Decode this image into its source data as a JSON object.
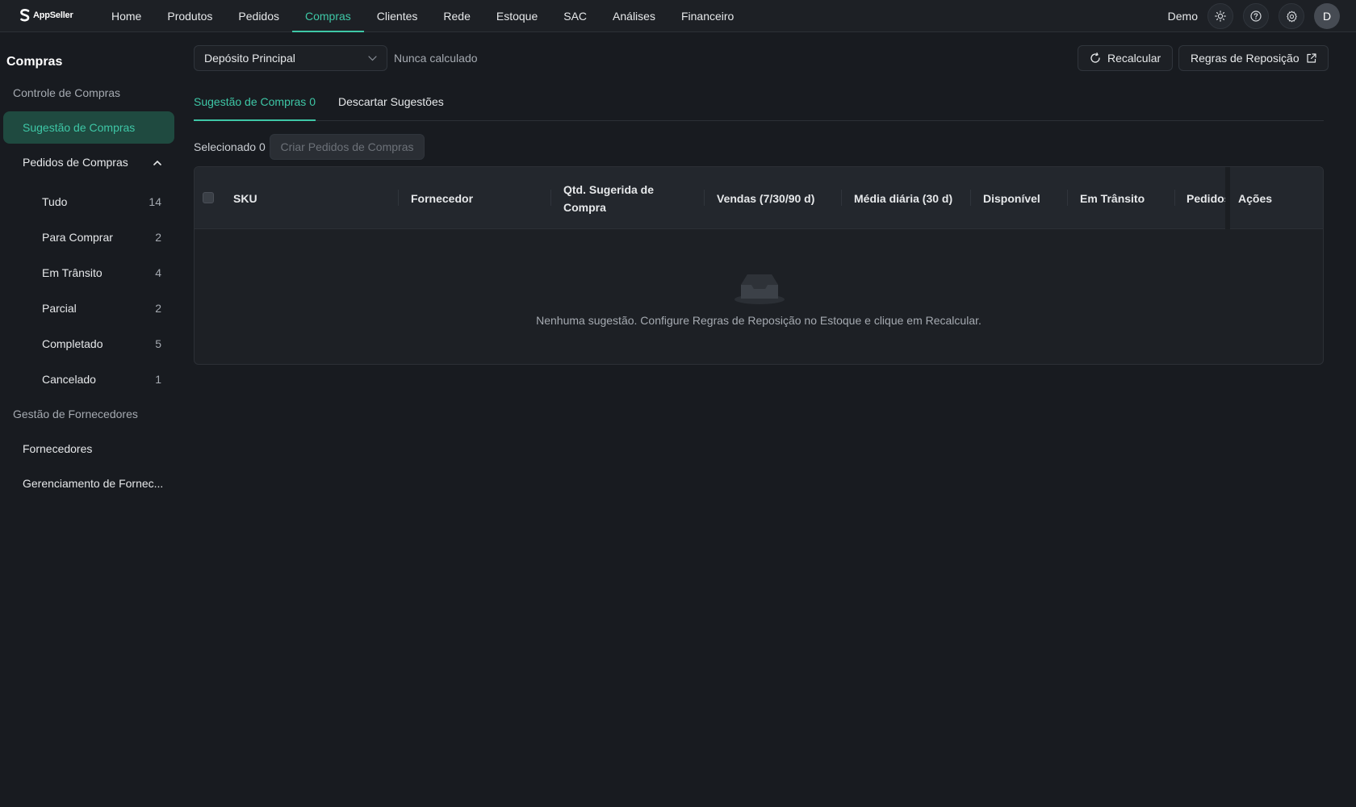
{
  "app": {
    "logo_text": "AppSeller"
  },
  "nav": {
    "items": [
      {
        "label": "Home"
      },
      {
        "label": "Produtos"
      },
      {
        "label": "Pedidos"
      },
      {
        "label": "Compras"
      },
      {
        "label": "Clientes"
      },
      {
        "label": "Rede"
      },
      {
        "label": "Estoque"
      },
      {
        "label": "SAC"
      },
      {
        "label": "Análises"
      },
      {
        "label": "Financeiro"
      }
    ],
    "active": "Compras"
  },
  "header_right": {
    "user_name": "Demo",
    "avatar_initial": "D"
  },
  "sidebar": {
    "title": "Compras",
    "group_control": "Controle de Compras",
    "suggestion": "Sugestão de Compras",
    "orders": "Pedidos de Compras",
    "sub": [
      {
        "label": "Tudo",
        "count": "14"
      },
      {
        "label": "Para Comprar",
        "count": "2"
      },
      {
        "label": "Em Trânsito",
        "count": "4"
      },
      {
        "label": "Parcial",
        "count": "2"
      },
      {
        "label": "Completado",
        "count": "5"
      },
      {
        "label": "Cancelado",
        "count": "1"
      }
    ],
    "group_suppliers": "Gestão de Fornecedores",
    "suppliers": "Fornecedores",
    "supplier_mgmt": "Gerenciamento de Fornec..."
  },
  "toolbar": {
    "warehouse": "Depósito Principal",
    "status": "Nunca calculado",
    "recalc": "Recalcular",
    "rules": "Regras de Reposição"
  },
  "tabs": {
    "suggestion": "Sugestão de Compras 0",
    "discard": "Descartar Sugestões"
  },
  "selection": {
    "label": "Selecionado 0",
    "create_button": "Criar Pedidos de Compras"
  },
  "table": {
    "columns": {
      "sku": "SKU",
      "supplier": "Fornecedor",
      "qty": "Qtd. Sugerida de Compra",
      "sales": "Vendas (7/30/90 d)",
      "avg": "Média diária (30 d)",
      "available": "Disponível",
      "transit": "Em Trânsito",
      "orders": "Pedidos",
      "actions": "Ações"
    },
    "empty_text": "Nenhuma sugestão. Configure Regras de Reposição no Estoque e clique em Recalcular."
  },
  "colors": {
    "accent": "#3ec7a6",
    "background": "#181b20"
  }
}
